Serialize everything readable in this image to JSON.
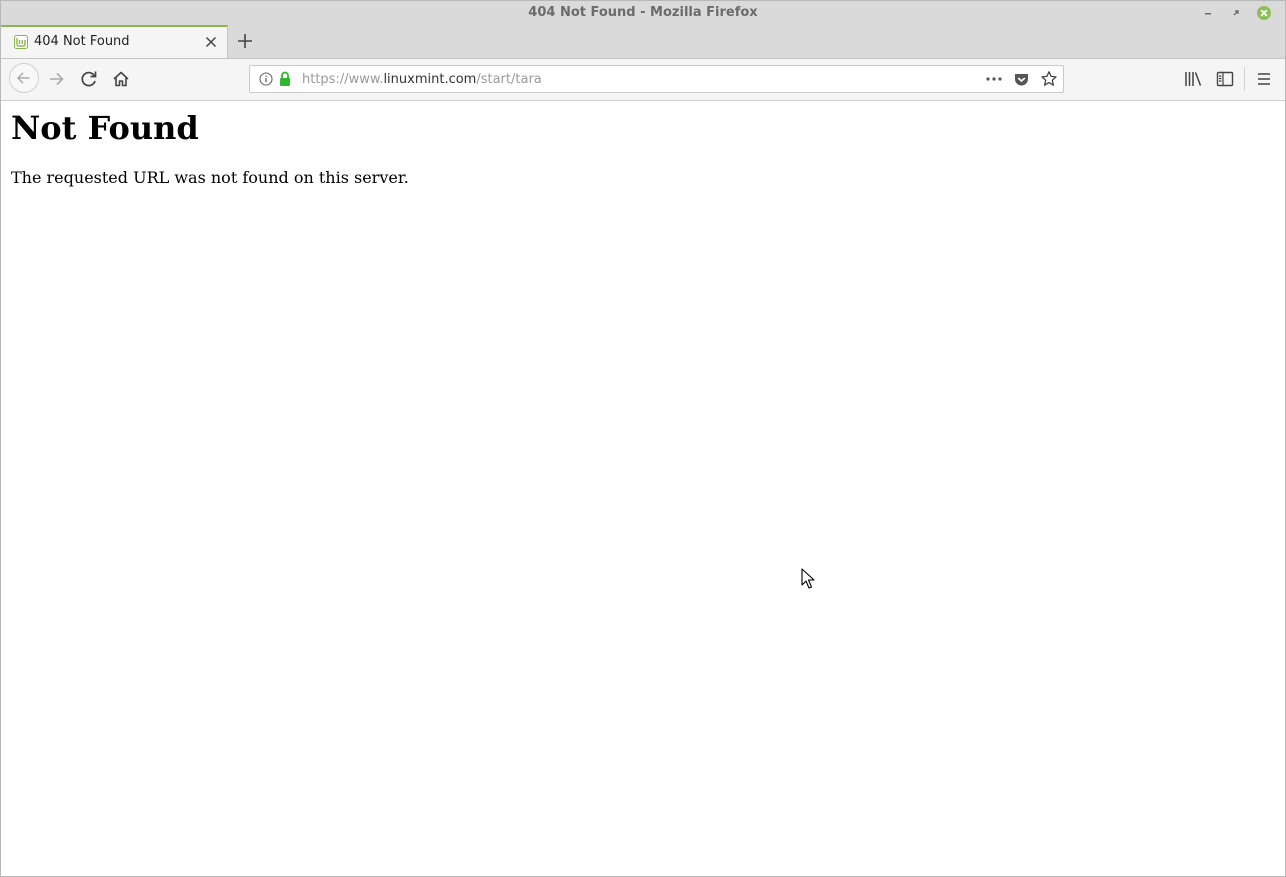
{
  "window": {
    "title": "404 Not Found - Mozilla Firefox"
  },
  "tabs": [
    {
      "title": "404 Not Found",
      "active": true
    }
  ],
  "urlbar": {
    "scheme_prefix": "https://www.",
    "domain": "linuxmint.com",
    "path": "/start/tara"
  },
  "page": {
    "heading": "Not Found",
    "message": "The requested URL was not found on this server."
  },
  "colors": {
    "tab_accent": "#8bb552",
    "lock_green": "#2eb82e",
    "close_button_green": "#8dbf57"
  },
  "icons": [
    "back-icon",
    "forward-icon",
    "reload-icon",
    "home-icon",
    "info-icon",
    "lock-icon",
    "more-icon",
    "pocket-icon",
    "star-icon",
    "library-icon",
    "sidebar-icon",
    "hamburger-menu-icon",
    "mint-favicon",
    "close-icon",
    "plus-icon"
  ]
}
